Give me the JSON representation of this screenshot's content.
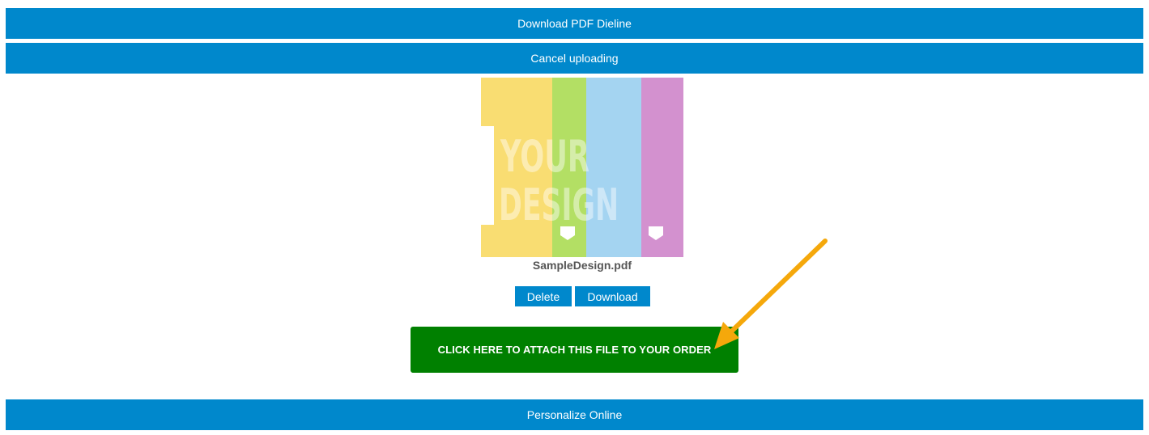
{
  "actions": {
    "download_dieline_label": "Download PDF Dieline",
    "cancel_upload_label": "Cancel uploading",
    "personalize_label": "Personalize Online"
  },
  "file": {
    "name": "SampleDesign.pdf",
    "preview_text_line1": "YOUR",
    "preview_text_line2": "DESIGN",
    "preview_colors": [
      "#f9dd72",
      "#b3df64",
      "#a4d4f1",
      "#d391cf"
    ]
  },
  "file_actions": {
    "delete_label": "Delete",
    "download_label": "Download"
  },
  "attach": {
    "label": "CLICK HERE TO ATTACH THIS FILE TO YOUR ORDER"
  },
  "colors": {
    "primary": "#0088cc",
    "attach_green": "#008000",
    "arrow": "#f5a80b"
  },
  "icons": {
    "annotation": "arrow-pointer-icon"
  }
}
